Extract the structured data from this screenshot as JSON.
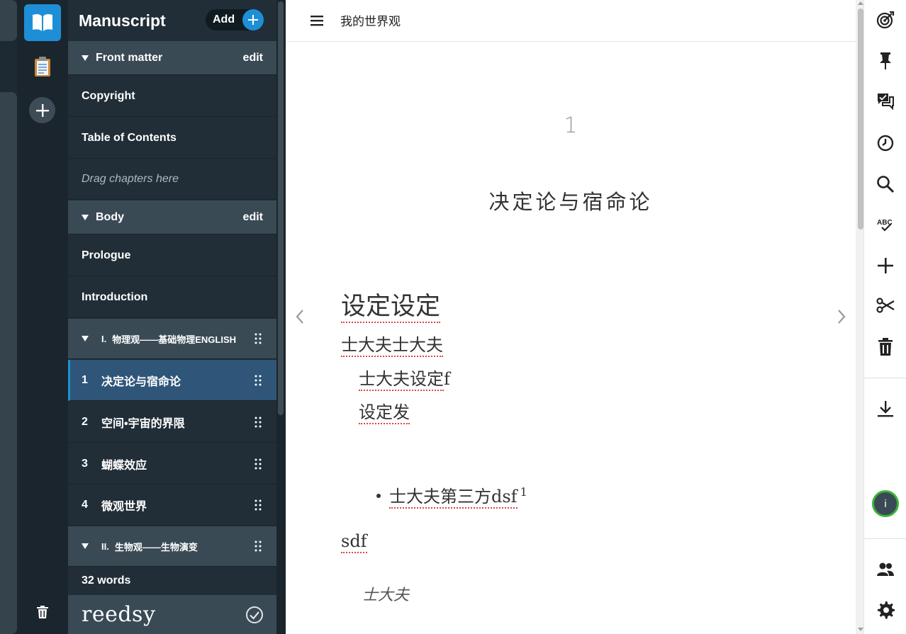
{
  "sidebar": {
    "title": "Manuscript",
    "add_label": "Add",
    "front_matter": {
      "label": "Front matter",
      "edit_label": "edit",
      "items": [
        "Copyright",
        "Table of Contents"
      ],
      "drop_hint": "Drag chapters here"
    },
    "body": {
      "label": "Body",
      "edit_label": "edit",
      "items": [
        "Prologue",
        "Introduction"
      ]
    },
    "parts": [
      {
        "number": "I.",
        "title": "物理观——基础物理ENGLISH",
        "chapters": [
          {
            "number": "1",
            "title": "决定论与宿命论",
            "selected": true
          },
          {
            "number": "2",
            "title": "空间•宇宙的界限"
          },
          {
            "number": "3",
            "title": "蝴蝶效应"
          },
          {
            "number": "4",
            "title": "微观世界"
          }
        ]
      },
      {
        "number": "II.",
        "title": "生物观——生物演变"
      }
    ],
    "word_count": "32 words",
    "brand": "reedsy"
  },
  "editor": {
    "doc_title": "我的世界观",
    "chapter_number": "1",
    "chapter_title": "决定论与宿命论",
    "content": {
      "heading": "设定设定",
      "para1": "士大夫士大夫",
      "para2_prefix": "士大夫设定",
      "para2_suffix": "f",
      "para3": "设定发",
      "bullet": "士大夫第三方dsf",
      "bullet_footnote": "1",
      "para4": "sdf",
      "para5": "士大夫"
    }
  },
  "right_rail": {
    "info_label": "i"
  },
  "colors": {
    "accent": "#1e8fd6",
    "sidebar_bg": "#212e37",
    "section_bg": "#3a4a55",
    "selected_bg": "#2f5678",
    "spell_error": "#dd4444",
    "info_ring": "#3bb33b"
  }
}
